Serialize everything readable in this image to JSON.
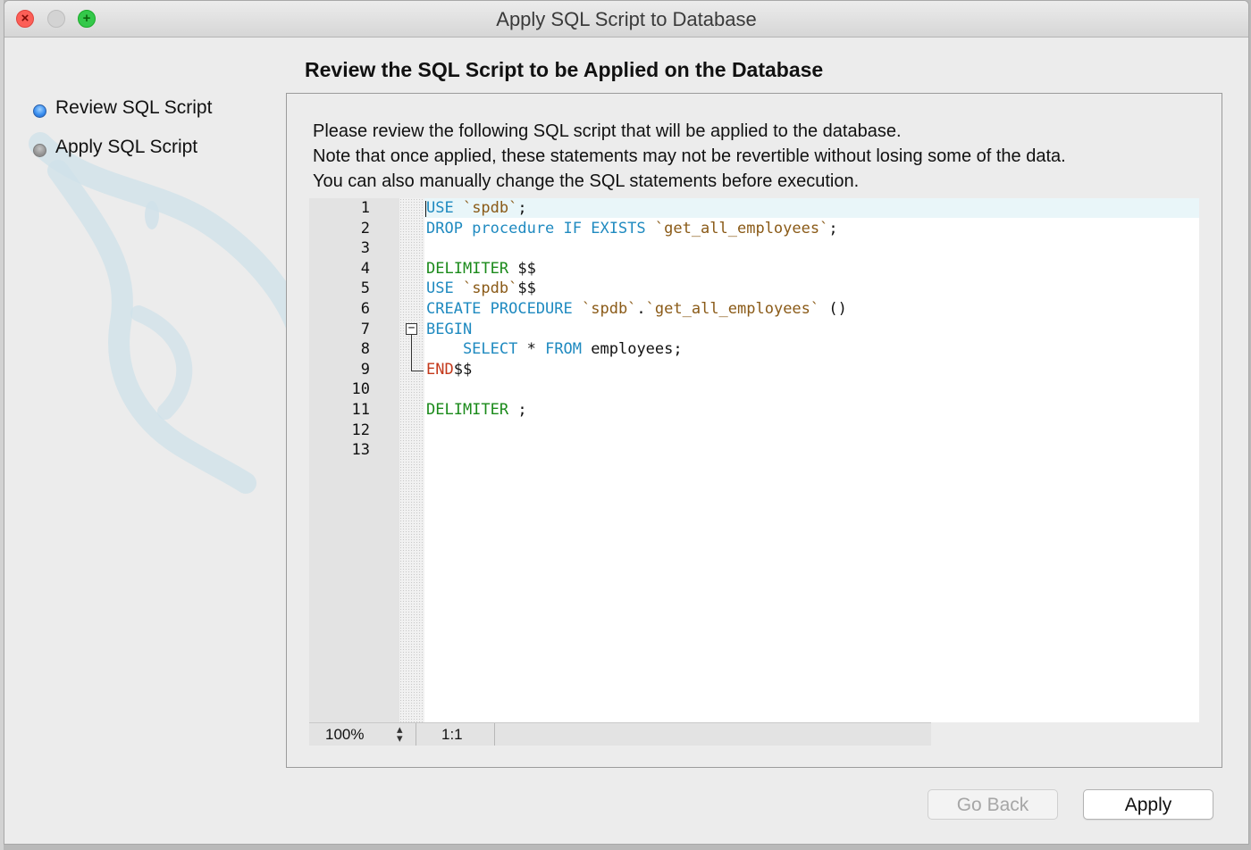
{
  "window": {
    "title": "Apply SQL Script to Database"
  },
  "traffic_lights": {
    "close_glyph": "×",
    "zoom_glyph": "+"
  },
  "steps": [
    {
      "label": "Review SQL Script",
      "state": "active"
    },
    {
      "label": "Apply SQL Script",
      "state": "inactive"
    }
  ],
  "main": {
    "title": "Review the SQL Script to be Applied on the Database",
    "description": [
      "Please review the following SQL script that will be applied to the database.",
      "Note that once applied, these statements may not be revertible without losing some of the data.",
      "You can also manually change the SQL statements before execution."
    ]
  },
  "editor": {
    "line_numbers": [
      "1",
      "2",
      "3",
      "4",
      "5",
      "6",
      "7",
      "8",
      "9",
      "10",
      "11",
      "12",
      "13"
    ],
    "lines": [
      [
        [
          "kw",
          "USE "
        ],
        [
          "st",
          "`spdb`"
        ],
        [
          "pl",
          ";"
        ]
      ],
      [
        [
          "kw",
          "DROP procedure IF EXISTS "
        ],
        [
          "st",
          "`get_all_employees`"
        ],
        [
          "pl",
          ";"
        ]
      ],
      [],
      [
        [
          "dl",
          "DELIMITER "
        ],
        [
          "pl",
          "$$"
        ]
      ],
      [
        [
          "kw",
          "USE "
        ],
        [
          "st",
          "`spdb`"
        ],
        [
          "pl",
          "$$"
        ]
      ],
      [
        [
          "kw",
          "CREATE PROCEDURE "
        ],
        [
          "st",
          "`spdb`"
        ],
        [
          "pl",
          "."
        ],
        [
          "st",
          "`get_all_employees`"
        ],
        [
          "pl",
          " ()"
        ]
      ],
      [
        [
          "kw",
          "BEGIN"
        ]
      ],
      [
        [
          "kw",
          "    SELECT "
        ],
        [
          "pl",
          "* "
        ],
        [
          "kw",
          "FROM "
        ],
        [
          "pl",
          "employees;"
        ]
      ],
      [
        [
          "en",
          "END"
        ],
        [
          "pl",
          "$$"
        ]
      ],
      [],
      [
        [
          "dl",
          "DELIMITER "
        ],
        [
          "pl",
          ";"
        ]
      ],
      [],
      []
    ],
    "fold_glyph": "−",
    "zoom": "100%",
    "cursor_position": "1:1",
    "colors": {
      "keyword": "#1f8ac0",
      "delimiter": "#1a8a1a",
      "string": "#8a5a17",
      "end": "#c4391b",
      "current_line": "#e9f6f9"
    }
  },
  "buttons": {
    "go_back": "Go Back",
    "apply": "Apply"
  }
}
